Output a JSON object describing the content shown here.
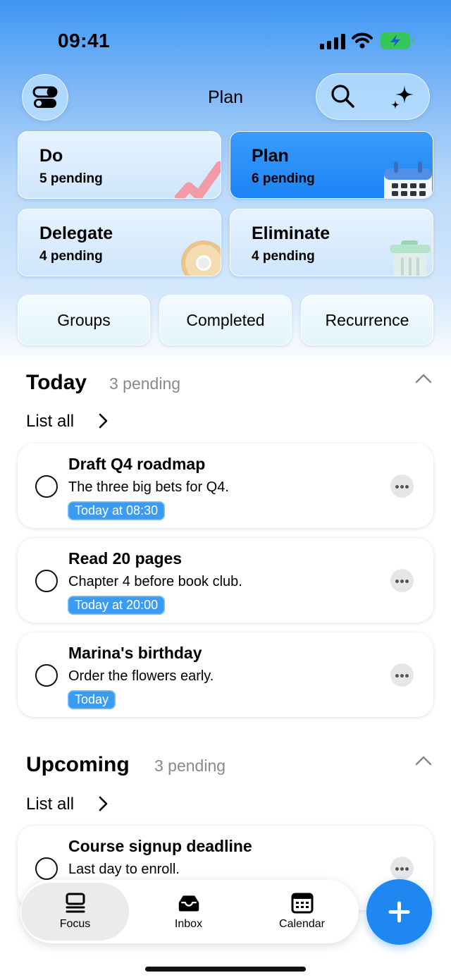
{
  "status_bar": {
    "time": "09:41"
  },
  "header": {
    "title": "Plan",
    "toggle_icon": "toggles-icon",
    "search_icon": "search-icon",
    "ai_icon": "sparkles-icon"
  },
  "quadrants": [
    {
      "title": "Do",
      "subtitle": "5 pending",
      "active": false,
      "illustration": "chart-icon"
    },
    {
      "title": "Plan",
      "subtitle": "6 pending",
      "active": true,
      "illustration": "calendar-icon"
    },
    {
      "title": "Delegate",
      "subtitle": "4 pending",
      "active": false,
      "illustration": "donut-icon"
    },
    {
      "title": "Eliminate",
      "subtitle": "4 pending",
      "active": false,
      "illustration": "trash-icon"
    }
  ],
  "filters": [
    {
      "label": "Groups"
    },
    {
      "label": "Completed"
    },
    {
      "label": "Recurrence"
    }
  ],
  "today": {
    "title": "Today",
    "count": "3 pending",
    "list_all": "List all",
    "tasks": [
      {
        "title": "Draft Q4 roadmap",
        "note": "The three big bets for Q4.",
        "due": "Today at 08:30"
      },
      {
        "title": "Read 20 pages",
        "note": "Chapter 4 before book club.",
        "due": "Today at 20:00"
      },
      {
        "title": "Marina's birthday",
        "note": "Order the flowers early.",
        "due": "Today"
      }
    ]
  },
  "upcoming": {
    "title": "Upcoming",
    "count": "3 pending",
    "list_all": "List all",
    "tasks": [
      {
        "title": "Course signup deadline",
        "note": "Last day to enroll."
      }
    ]
  },
  "tab_bar": {
    "tabs": [
      {
        "label": "Focus",
        "icon": "focus-icon",
        "selected": true
      },
      {
        "label": "Inbox",
        "icon": "inbox-icon",
        "selected": false
      },
      {
        "label": "Calendar",
        "icon": "calendar-icon",
        "selected": false
      }
    ],
    "add_icon": "plus-icon"
  },
  "colors": {
    "accent": "#1f87f0",
    "tag": "#3b9bf0"
  }
}
